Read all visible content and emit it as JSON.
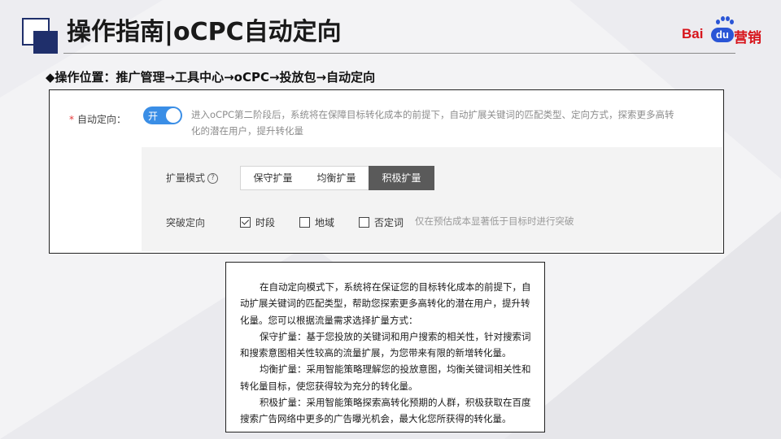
{
  "header": {
    "title": "操作指南|oCPC自动定向"
  },
  "logo": {
    "part1": "Bai",
    "part2": "du",
    "part3": "营销"
  },
  "operation_path": "◆操作位置：推广管理→工具中心→oCPC→投放包→自动定向",
  "panel": {
    "required_mark": "*",
    "auto_targeting_label": "自动定向：",
    "toggle_label": "开",
    "description": "进入oCPC第二阶段后，系统将在保障目标转化成本的前提下，自动扩展关键词的匹配类型、定向方式，探索更多高转化的潜在用户，提升转化量",
    "expansion_mode_label": "扩量模式",
    "help_icon": "?",
    "modes": [
      "保守扩量",
      "均衡扩量",
      "积极扩量"
    ],
    "selected_mode": "积极扩量",
    "breakthrough_label": "突破定向",
    "checkboxes": [
      {
        "label": "时段",
        "checked": true
      },
      {
        "label": "地域",
        "checked": false
      },
      {
        "label": "否定词",
        "checked": false
      }
    ],
    "breakthrough_hint": "仅在预估成本显著低于目标时进行突破"
  },
  "note": {
    "paragraphs": [
      "在自动定向模式下，系统将在保证您的目标转化成本的前提下，自动扩展关键词的匹配类型，帮助您探索更多高转化的潜在用户，提升转化量。您可以根据流量需求选择扩量方式：",
      "保守扩量：基于您投放的关键词和用户搜索的相关性，针对搜索词和搜索意图相关性较高的流量扩展，为您带来有限的新增转化量。",
      "均衡扩量：采用智能策略理解您的投放意图，均衡关键词相关性和转化量目标，使您获得较为充分的转化量。",
      "积极扩量：采用智能策略探索高转化预期的人群，积极获取在百度搜索广告网络中更多的广告曝光机会，最大化您所获得的转化量。"
    ]
  },
  "colors": {
    "brand_navy": "#1f2f6b",
    "toggle_blue": "#3a8ee6",
    "selected_mode": "#5a5a5a",
    "required_red": "#e43a3a",
    "baidu_red": "#d7141b",
    "baidu_blue": "#2a55d6"
  }
}
